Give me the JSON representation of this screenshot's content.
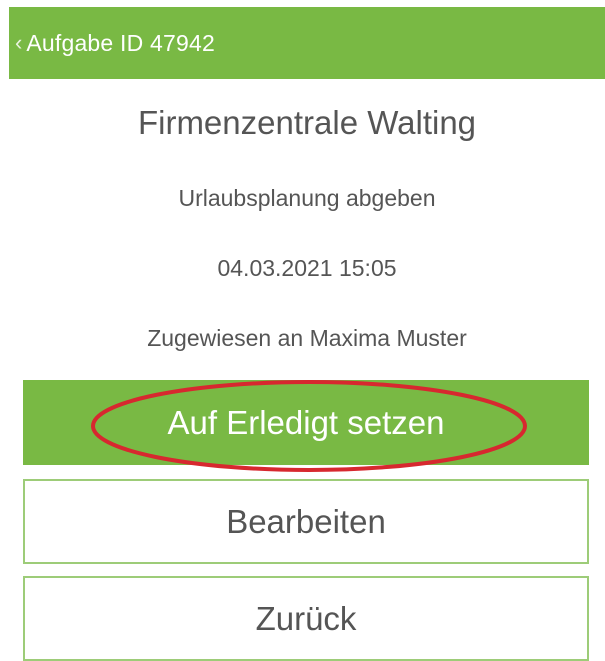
{
  "header": {
    "back_icon": "‹",
    "title": "Aufgabe ID 47942"
  },
  "task": {
    "location": "Firmenzentrale Walting",
    "description": "Urlaubsplanung abgeben",
    "datetime": "04.03.2021 15:05",
    "assigned_to": "Zugewiesen an Maxima Muster"
  },
  "actions": {
    "complete_label": "Auf Erledigt setzen",
    "edit_label": "Bearbeiten",
    "back_label": "Zurück"
  },
  "colors": {
    "accent": "#79b944",
    "highlight": "#d7282f"
  }
}
